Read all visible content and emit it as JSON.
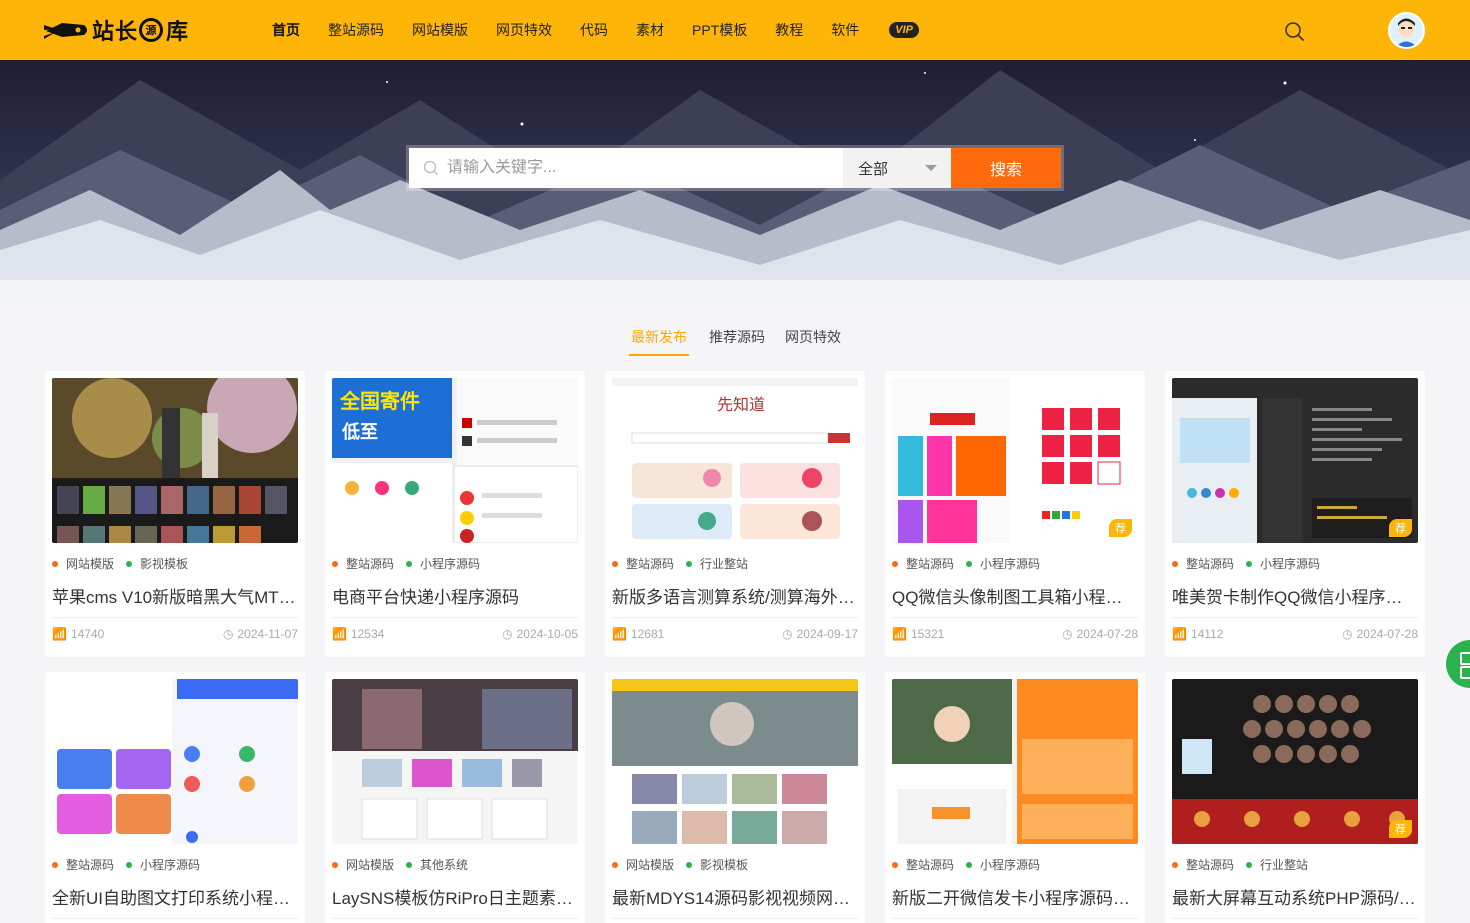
{
  "header": {
    "logo_text": "站长",
    "logo_badge": "源",
    "logo_text2": "库",
    "nav": [
      "首页",
      "整站源码",
      "网站模版",
      "网页特效",
      "代码",
      "素材",
      "PPT模板",
      "教程",
      "软件"
    ],
    "vip": "VIP"
  },
  "search": {
    "placeholder": "请输入关键字...",
    "scope": "全部",
    "submit": "搜索"
  },
  "tabs": [
    "最新发布",
    "推荐源码",
    "网页特效"
  ],
  "rec_label": "荐",
  "cards": [
    {
      "cat1": "网站模版",
      "cat2": "影视模板",
      "title": "苹果cms V10新版暗黑大气MT…",
      "views": "14740",
      "date": "2024-11-07",
      "thumb": "dark-movie"
    },
    {
      "cat1": "整站源码",
      "cat2": "小程序源码",
      "title": "电商平台快递小程序源码",
      "views": "12534",
      "date": "2024-10-05",
      "thumb": "express"
    },
    {
      "cat1": "整站源码",
      "cat2": "行业整站",
      "title": "新版多语言测算系统/测算海外…",
      "views": "12681",
      "date": "2024-09-17",
      "thumb": "fortune"
    },
    {
      "cat1": "整站源码",
      "cat2": "小程序源码",
      "title": "QQ微信头像制图工具箱小程…",
      "views": "15321",
      "date": "2024-07-28",
      "thumb": "avatar-tool"
    },
    {
      "cat1": "整站源码",
      "cat2": "小程序源码",
      "title": "唯美贺卡制作QQ微信小程序…",
      "views": "14112",
      "date": "2024-07-28",
      "thumb": "card-maker"
    },
    {
      "cat1": "整站源码",
      "cat2": "小程序源码",
      "title": "全新UI自助图文打印系统小程…",
      "views": "",
      "date": "",
      "thumb": "print"
    },
    {
      "cat1": "网站模版",
      "cat2": "其他系统",
      "title": "LaySNS模板仿RiPro日主题素…",
      "views": "",
      "date": "",
      "thumb": "laysns"
    },
    {
      "cat1": "网站模版",
      "cat2": "影视模板",
      "title": "最新MDYS14源码影视视频网…",
      "views": "",
      "date": "",
      "thumb": "mdys"
    },
    {
      "cat1": "整站源码",
      "cat2": "小程序源码",
      "title": "新版二开微信发卡小程序源码…",
      "views": "",
      "date": "",
      "thumb": "fake"
    },
    {
      "cat1": "整站源码",
      "cat2": "行业整站",
      "title": "最新大屏幕互动系统PHP源码/…",
      "views": "",
      "date": "",
      "thumb": "bigscreen"
    }
  ],
  "colors": {
    "brand": "#ffb508",
    "accent": "#ff6a0d",
    "green": "#2bb24c"
  }
}
